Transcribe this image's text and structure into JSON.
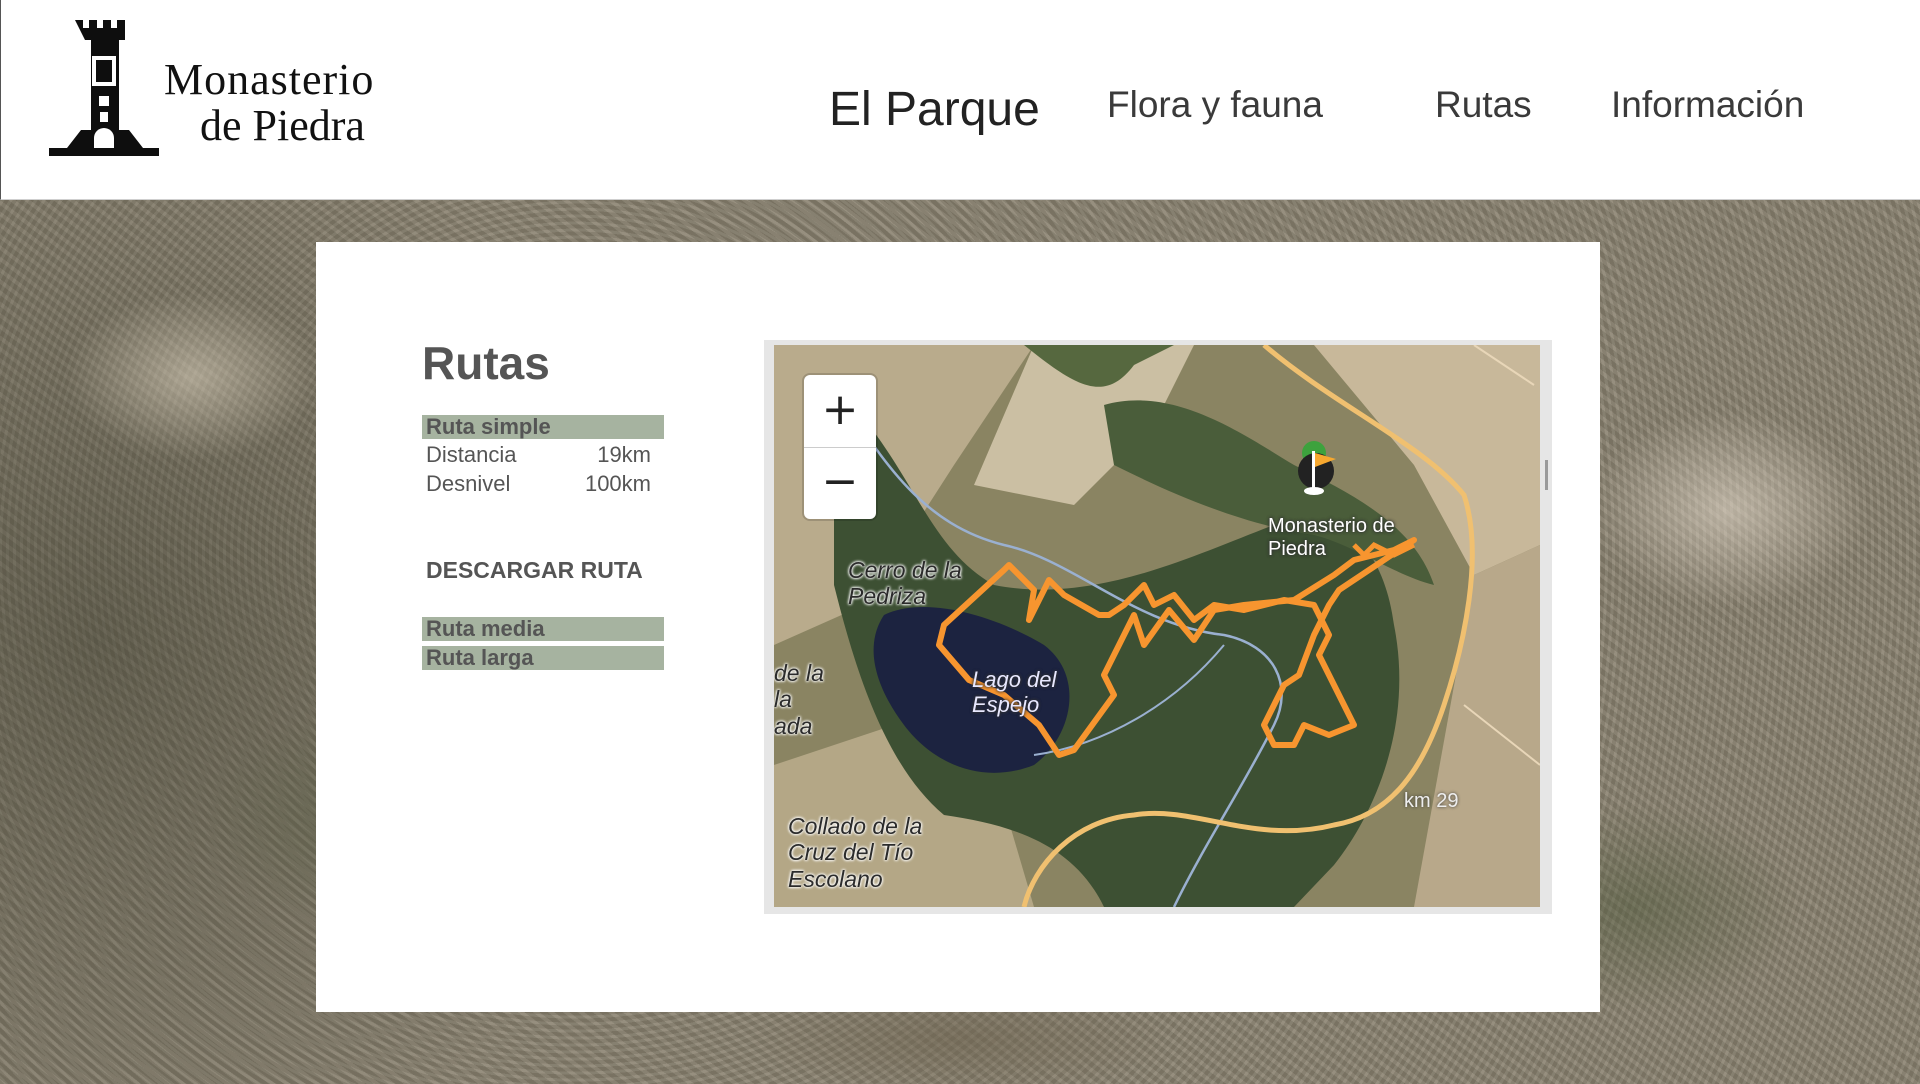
{
  "brand": {
    "line1": "Monasterio",
    "line2": "de Piedra",
    "logo_icon": "tower-icon"
  },
  "nav": {
    "items": [
      {
        "label": "El Parque"
      },
      {
        "label": "Flora y fauna"
      },
      {
        "label": "Rutas"
      },
      {
        "label": "Información"
      }
    ]
  },
  "main": {
    "title": "Rutas",
    "routes": [
      {
        "label": "Ruta simple"
      },
      {
        "label": "Ruta media"
      },
      {
        "label": "Ruta larga"
      }
    ],
    "stats": [
      {
        "label": "Distancia",
        "value": "19km"
      },
      {
        "label": "Desnivel",
        "value": "100km"
      }
    ],
    "download_label": "DESCARGAR RUTA"
  },
  "map": {
    "zoom_in": "+",
    "zoom_out": "−",
    "labels": {
      "cerro": "Cerro de la\nPedriza",
      "lago": "Lago del\nEspejo",
      "dela": "de la\nla\nada",
      "collado": "Collado de la\nCruz del Tío\nEscolano",
      "monasterio": "Monasterio de\nPiedra",
      "km": "km 29"
    },
    "colors": {
      "route": "#f7952f",
      "road": "#f0c070",
      "route_bar_bg": "#a6b3a0"
    },
    "marker_icon": "flag-marker-icon"
  }
}
